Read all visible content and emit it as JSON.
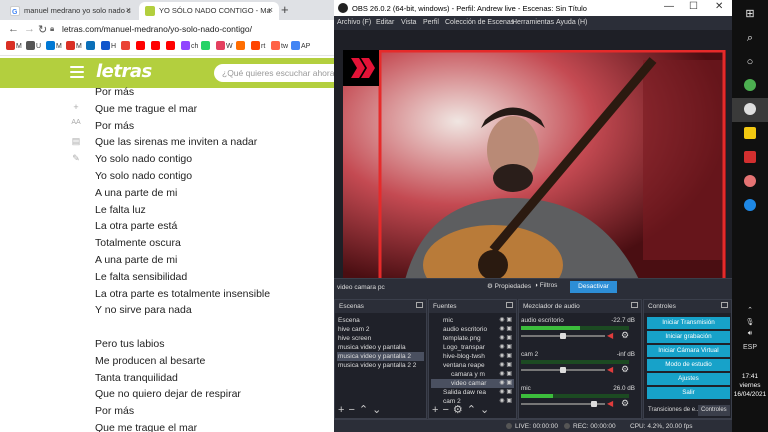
{
  "browser": {
    "tabs": [
      {
        "title": "manuel medrano yo solo nado c",
        "favicon_color": "#4285f4"
      },
      {
        "title": "YO SÓLO NADO CONTIGO - Ma",
        "favicon_color": "#b3cf3e"
      }
    ],
    "new_tab": "+",
    "url": "letras.com/manuel-medrano/yo-solo-nado-contigo/",
    "bookmarks": [
      {
        "label": "M",
        "color": "#d93025"
      },
      {
        "label": "U",
        "color": "#555555"
      },
      {
        "label": "M",
        "color": "#0078d4"
      },
      {
        "label": "M",
        "color": "#d93025"
      },
      {
        "label": "",
        "color": "#0b6fb8"
      },
      {
        "label": "H",
        "color": "#1155cc"
      },
      {
        "label": "",
        "color": "#ea4335"
      },
      {
        "label": "",
        "color": "#ff0000"
      },
      {
        "label": "",
        "color": "#ff0000"
      },
      {
        "label": "",
        "color": "#ff0000"
      },
      {
        "label": "ch",
        "color": "#9146ff"
      },
      {
        "label": "",
        "color": "#25d366"
      },
      {
        "label": "W",
        "color": "#e4405f"
      },
      {
        "label": "",
        "color": "#ff6d00"
      },
      {
        "label": "rt",
        "color": "#ff4500"
      },
      {
        "label": "tw",
        "color": "#ff6347"
      },
      {
        "label": "AP",
        "color": "#4285f4"
      }
    ],
    "site": {
      "logo": "letras",
      "search_placeholder": "¿Qué quieres escuchar ahora?"
    },
    "side_icons": [
      "plus-icon",
      "font-size-icon",
      "print-icon",
      "pencil-icon"
    ],
    "lyrics": [
      "Por más",
      "Que me trague el mar",
      "Por más",
      "Que las sirenas me inviten a nadar",
      "Yo solo nado contigo",
      "Yo solo nado contigo",
      "A una parte de mi",
      "Le falta luz",
      "La otra parte está",
      "Totalmente oscura",
      "A una parte de mi",
      "Le falta sensibilidad",
      "La otra parte es totalmente insensible",
      "Y no sirve para nada",
      "",
      "Pero tus labios",
      "Me producen al besarte",
      "Tanta tranquilidad",
      "Que no quiero dejar de respirar",
      "Por más",
      "Que me trague el mar"
    ]
  },
  "obs": {
    "title": "OBS 26.0.2 (64-bit, windows) - Perfil: Andrew live - Escenas: Sin Título",
    "menu": [
      "Archivo (F)",
      "Editar",
      "Vista",
      "Perfil",
      "Colección de Escenas",
      "Herramientas",
      "Ayuda (H)"
    ],
    "source_bar": {
      "selected_source": "video camara pc",
      "properties": "Propiedades",
      "filters": "Filtros",
      "deactivate": "Desactivar"
    },
    "scenes": {
      "header": "Escenas",
      "items": [
        "Escena",
        "hive cam 2",
        "hive screen",
        "musica video y pantalla",
        "musica video y pantalla 2",
        "musica video y pantalla 2 2"
      ],
      "selected_index": 4
    },
    "sources": {
      "header": "Fuentes",
      "items": [
        "mic",
        "audio escritorio",
        "template.png",
        "Logo_transpar",
        "hive-blog-twsh",
        "ventana reape",
        "camara y m",
        "video camar",
        "Salida daw rea",
        "cam 2"
      ]
    },
    "mixer": {
      "header": "Mezclador de audio",
      "channels": [
        {
          "name": "audio escritorio",
          "db": "-22.7 dB",
          "level": 0.55,
          "volume": 0.5
        },
        {
          "name": "cam 2",
          "db": "-inf dB",
          "level": 0.0,
          "volume": 0.5
        },
        {
          "name": "mic",
          "db": "26.0 dB",
          "level": 0.3,
          "volume": 0.9
        }
      ]
    },
    "controls": {
      "header": "Controles",
      "buttons": [
        "Iniciar Transmisión",
        "Iniciar grabación",
        "Iniciar Cámara Virtual",
        "Modo de estudio",
        "Ajustes",
        "Salir"
      ],
      "tabs": [
        "Transiciones de e...",
        "Controles"
      ]
    },
    "status": {
      "live": "LIVE: 00:00:00",
      "rec": "REC: 00:00:00",
      "cpu": "CPU: 4.2%, 20.00 fps"
    }
  },
  "taskbar": {
    "tray_lang": "ESP",
    "time": "17:41",
    "day": "viernes",
    "date": "16/04/2021"
  }
}
